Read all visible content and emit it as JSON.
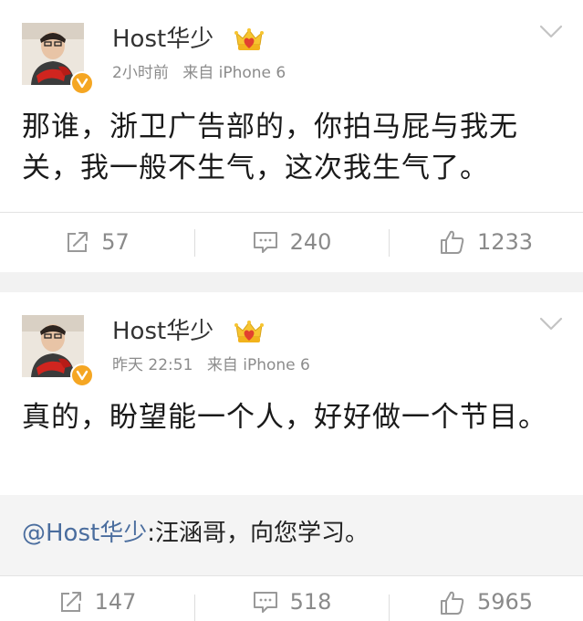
{
  "colors": {
    "background": "#f2f2f2",
    "card": "#ffffff",
    "mention_link": "#4a6d9e",
    "meta_text": "#8c8c8c",
    "verified_badge": "#f5a623"
  },
  "posts": [
    {
      "username": "Host华少",
      "time": "2小时前",
      "source": "来自 iPhone 6",
      "content": "那谁，浙卫广告部的，你拍马屁与我无关，我一般不生气，这次我生气了。",
      "actions": {
        "repost_icon": "repost-icon",
        "repost_count": "57",
        "comment_icon": "comment-icon",
        "comment_count": "240",
        "like_icon": "like-icon",
        "like_count": "1233"
      }
    },
    {
      "username": "Host华少",
      "time": "昨天 22:51",
      "source": "来自 iPhone 6",
      "content": "真的，盼望能一个人，好好做一个节目。",
      "retweet": {
        "mention": "@Host华少",
        "text": ":汪涵哥，向您学习。"
      },
      "actions": {
        "repost_icon": "repost-icon",
        "repost_count": "147",
        "comment_icon": "comment-icon",
        "comment_count": "518",
        "like_icon": "like-icon",
        "like_count": "5965"
      }
    }
  ]
}
